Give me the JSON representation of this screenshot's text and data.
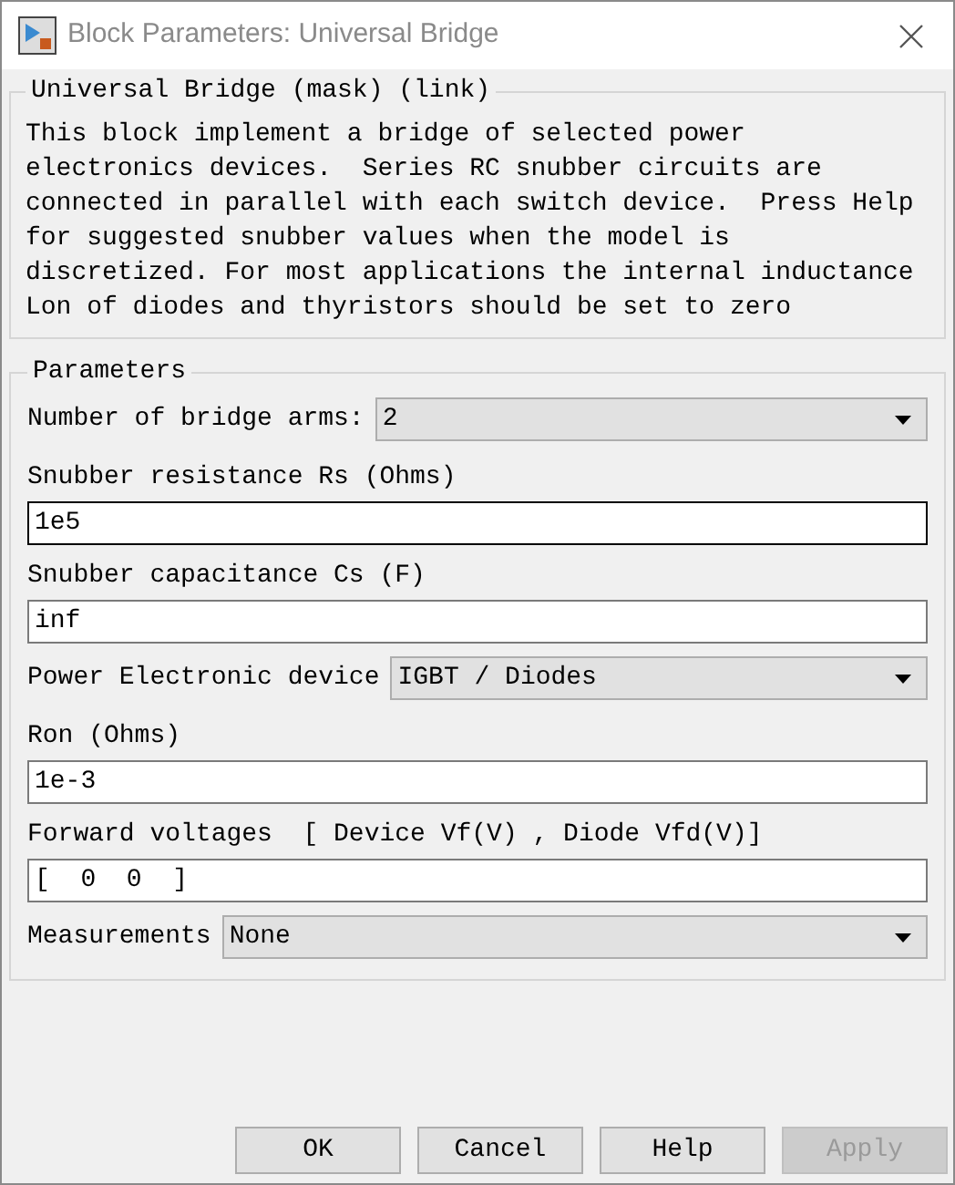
{
  "window": {
    "title": "Block Parameters: Universal Bridge"
  },
  "mask": {
    "title": "Universal Bridge (mask) (link)",
    "description": [
      "This block implement a bridge of selected power",
      "electronics devices.  Series RC snubber circuits are",
      "connected in parallel with each switch device.  Press Help",
      "for suggested snubber values when the model is",
      "discretized. For most applications the internal inductance",
      "Lon of diodes and thyristors should be set to zero"
    ]
  },
  "parameters": {
    "title": "Parameters",
    "fields": [
      {
        "kind": "dropdown",
        "label": "Number of bridge arms:",
        "value": "2"
      },
      {
        "kind": "text",
        "label": "Snubber resistance Rs (Ohms)",
        "value": "1e5",
        "focused": true
      },
      {
        "kind": "text",
        "label": "Snubber capacitance Cs (F)",
        "value": "inf",
        "focused": false
      },
      {
        "kind": "dropdown",
        "label": "Power Electronic device",
        "value": "IGBT / Diodes"
      },
      {
        "kind": "text",
        "label": "Ron (Ohms)",
        "value": "1e-3",
        "focused": false
      },
      {
        "kind": "text",
        "label": "Forward voltages  [ Device Vf(V) , Diode Vfd(V)]",
        "value": "[  0  0  ]",
        "focused": false
      },
      {
        "kind": "dropdown",
        "label": "Measurements",
        "value": "None"
      }
    ]
  },
  "buttons": [
    {
      "label": "OK",
      "disabled": false
    },
    {
      "label": "Cancel",
      "disabled": false
    },
    {
      "label": "Help",
      "disabled": false
    },
    {
      "label": "Apply",
      "disabled": true
    }
  ]
}
